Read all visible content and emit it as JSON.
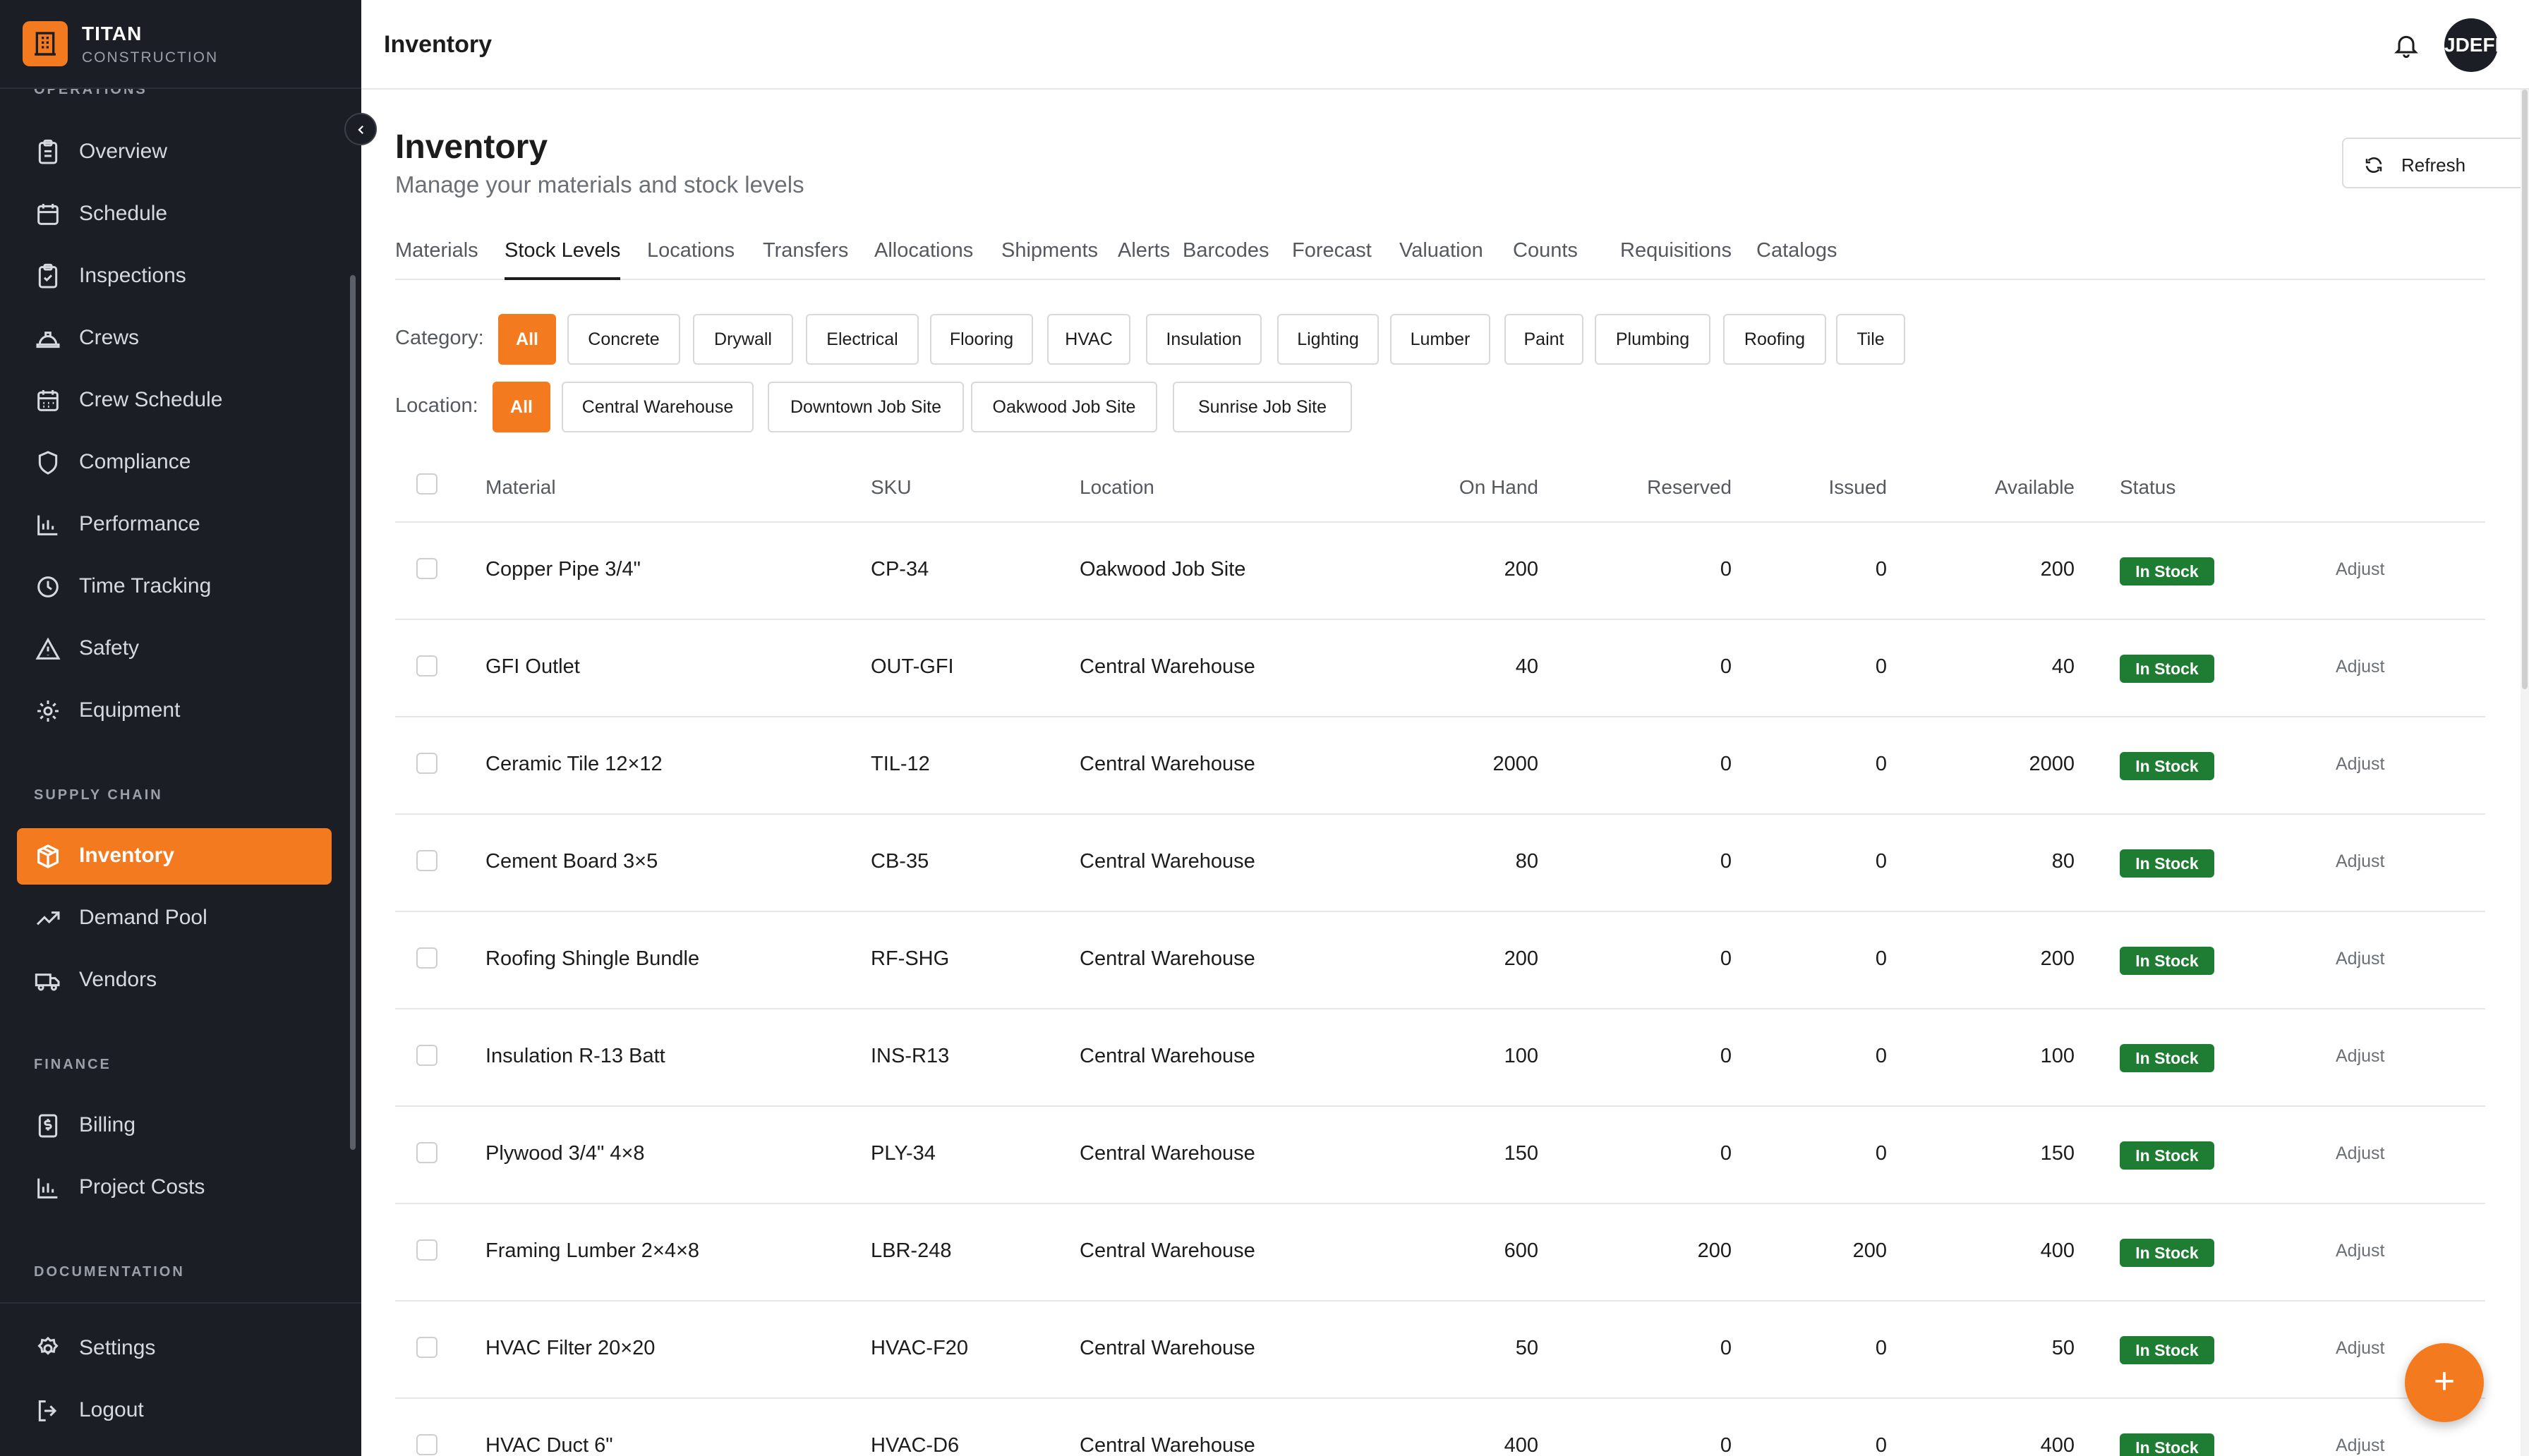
{
  "brand": {
    "name": "TITAN",
    "sub": "CONSTRUCTION"
  },
  "sidebar": {
    "partial_section": "OPERATIONS",
    "sections": {
      "supply_chain": "SUPPLY CHAIN",
      "finance": "FINANCE",
      "documentation": "DOCUMENTATION"
    },
    "items": [
      {
        "label": "Overview",
        "icon": "clipboard-icon"
      },
      {
        "label": "Schedule",
        "icon": "calendar-icon"
      },
      {
        "label": "Inspections",
        "icon": "clipboard-check-icon"
      },
      {
        "label": "Crews",
        "icon": "hard-hat-icon"
      },
      {
        "label": "Crew Schedule",
        "icon": "calendar-grid-icon"
      },
      {
        "label": "Compliance",
        "icon": "shield-icon"
      },
      {
        "label": "Performance",
        "icon": "bar-chart-icon"
      },
      {
        "label": "Time Tracking",
        "icon": "clock-icon"
      },
      {
        "label": "Safety",
        "icon": "warning-triangle-icon"
      },
      {
        "label": "Equipment",
        "icon": "gear-icon"
      },
      {
        "label": "Inventory",
        "icon": "package-icon"
      },
      {
        "label": "Demand Pool",
        "icon": "trend-up-icon"
      },
      {
        "label": "Vendors",
        "icon": "truck-icon"
      },
      {
        "label": "Billing",
        "icon": "receipt-icon"
      },
      {
        "label": "Project Costs",
        "icon": "bar-chart-icon"
      },
      {
        "label": "Settings",
        "icon": "settings-icon"
      },
      {
        "label": "Logout",
        "icon": "logout-icon"
      }
    ]
  },
  "topbar": {
    "title": "Inventory",
    "avatar": "JDEFI"
  },
  "page": {
    "title": "Inventory",
    "subtitle": "Manage your materials and stock levels",
    "refresh_label": "Refresh"
  },
  "tabs": [
    "Materials",
    "Stock Levels",
    "Locations",
    "Transfers",
    "Allocations",
    "Shipments",
    "Alerts",
    "Barcodes",
    "Forecast",
    "Valuation",
    "Counts",
    "Requisitions",
    "Catalogs"
  ],
  "filters": {
    "category_label": "Category:",
    "categories": [
      "All",
      "Concrete",
      "Drywall",
      "Electrical",
      "Flooring",
      "HVAC",
      "Insulation",
      "Lighting",
      "Lumber",
      "Paint",
      "Plumbing",
      "Roofing",
      "Tile"
    ],
    "location_label": "Location:",
    "locations": [
      "All",
      "Central Warehouse",
      "Downtown Job Site",
      "Oakwood Job Site",
      "Sunrise Job Site"
    ]
  },
  "table": {
    "headers": [
      "Material",
      "SKU",
      "Location",
      "On Hand",
      "Reserved",
      "Issued",
      "Available",
      "Status"
    ],
    "action_label": "Adjust",
    "rows": [
      [
        "Copper Pipe 3/4\"",
        "CP-34",
        "Oakwood Job Site",
        "200",
        "0",
        "0",
        "200",
        "In Stock"
      ],
      [
        "GFI Outlet",
        "OUT-GFI",
        "Central Warehouse",
        "40",
        "0",
        "0",
        "40",
        "In Stock"
      ],
      [
        "Ceramic Tile 12×12",
        "TIL-12",
        "Central Warehouse",
        "2000",
        "0",
        "0",
        "2000",
        "In Stock"
      ],
      [
        "Cement Board 3×5",
        "CB-35",
        "Central Warehouse",
        "80",
        "0",
        "0",
        "80",
        "In Stock"
      ],
      [
        "Roofing Shingle Bundle",
        "RF-SHG",
        "Central Warehouse",
        "200",
        "0",
        "0",
        "200",
        "In Stock"
      ],
      [
        "Insulation R-13 Batt",
        "INS-R13",
        "Central Warehouse",
        "100",
        "0",
        "0",
        "100",
        "In Stock"
      ],
      [
        "Plywood 3/4\" 4×8",
        "PLY-34",
        "Central Warehouse",
        "150",
        "0",
        "0",
        "150",
        "In Stock"
      ],
      [
        "Framing Lumber 2×4×8",
        "LBR-248",
        "Central Warehouse",
        "600",
        "200",
        "200",
        "400",
        "In Stock"
      ],
      [
        "HVAC Filter 20×20",
        "HVAC-F20",
        "Central Warehouse",
        "50",
        "0",
        "0",
        "50",
        "In Stock"
      ],
      [
        "HVAC Duct 6\"",
        "HVAC-D6",
        "Central Warehouse",
        "400",
        "0",
        "0",
        "400",
        "In Stock"
      ]
    ]
  },
  "fab": "+",
  "colors": {
    "accent": "#f47a1f",
    "sidebar": "#1b1e24",
    "in_stock": "#1e7d32"
  }
}
